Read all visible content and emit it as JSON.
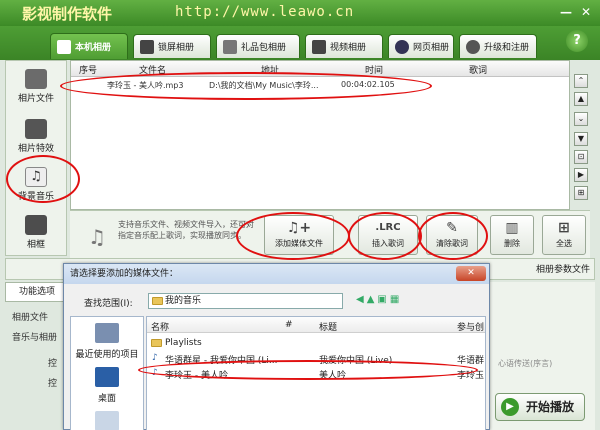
{
  "app": {
    "title": "影视制作软件",
    "url": "http://www.leawo.cn",
    "min_label": "—",
    "close_label": "✕"
  },
  "tabs": [
    {
      "label": "本机相册"
    },
    {
      "label": "锁屏相册"
    },
    {
      "label": "礼品包相册"
    },
    {
      "label": "视频相册"
    },
    {
      "label": "网页相册"
    },
    {
      "label": "升级和注册"
    }
  ],
  "help_label": "?",
  "left_panel": [
    {
      "label": "相片文件",
      "icon": "camera-icon"
    },
    {
      "label": "相片特效",
      "icon": "sparkle-icon"
    },
    {
      "label": "背景音乐",
      "icon": "music-note-icon"
    },
    {
      "label": "相框",
      "icon": "picture-frame-icon"
    }
  ],
  "list": {
    "headers": {
      "index": "序号",
      "filename": "文件名",
      "path": "地址",
      "time": "时间",
      "lyrics": "歌词"
    },
    "rows": [
      {
        "filename": "李玲玉 - 美人吟.mp3",
        "path": "D:\\我的文档\\My Music\\李玲...",
        "time": "00:04:02.105"
      }
    ]
  },
  "scroll_buttons": [
    "⌃",
    "▲",
    "⌄",
    "▼",
    "⊡",
    "▶",
    "⊞"
  ],
  "toolbar": {
    "tip": "支持音乐文件、视频文件导入，还可对指定音乐配上歌词，实现播放同步。",
    "add_media": "添加媒体文件",
    "lrc_glyph": ".LRC",
    "insert_lyrics": "插入歌词",
    "clear_lyrics": "清除歌词",
    "delete": "删除",
    "select_all": "全选"
  },
  "bottom": {
    "album_params": "相册参数文件",
    "func_tab": "功能选项",
    "labels": [
      "相册文件",
      "音乐与相册",
      "控",
      "控"
    ],
    "heart_label": "心语传送(序言)",
    "play_label": "开始播放"
  },
  "dialog": {
    "title": "请选择要添加的媒体文件：",
    "lookin_label": "查找范围(I):",
    "lookin_value": "我的音乐",
    "places": [
      "最近使用的项目",
      "桌面"
    ],
    "headers": {
      "name": "名称",
      "num": "#",
      "title": "标题",
      "artist": "参与创"
    },
    "rows": [
      {
        "name": "Playlists",
        "num": "",
        "title": "",
        "artist": ""
      },
      {
        "name": "华语群星 - 我爱你中国 (Li...",
        "num": "",
        "title": "我爱你中国 (Live)",
        "artist": "华语群"
      },
      {
        "name": "李玲玉 - 美人吟",
        "num": "",
        "title": "美人吟",
        "artist": "李玲玉"
      }
    ]
  },
  "colors": {
    "brand_green": "#3c8a26",
    "annotation_red": "#e01010"
  }
}
